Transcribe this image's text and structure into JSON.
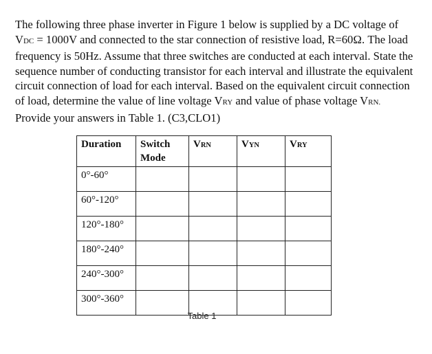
{
  "question": {
    "lines": [
      "The following three phase inverter in Figure 1 below is supplied by a DC voltage of",
      "and connected to the star connection of resistive load, R=60Ω. The load",
      "frequency is 50Hz. Assume that three switches are conducted at each interval. State the",
      "sequence number of conducting transistor for each interval and illustrate the equivalent",
      "circuit connection of load for each interval. Based on the equivalent circuit connection",
      "of load, determine the value of line voltage",
      "and value of phase voltage",
      "Provide your answers in Table 1. (C3,CLO1)"
    ],
    "vdc_symbol": "V",
    "vdc_sub": "DC",
    "vdc_value": " = 1000V ",
    "vry_symbol": "V",
    "vry_sub": "RY",
    "vrn_symbol": "V",
    "vrn_sub": "RN."
  },
  "table": {
    "headers": [
      {
        "main": "Duration",
        "sub": ""
      },
      {
        "main": "Switch Mode",
        "sub": ""
      },
      {
        "main": "V",
        "sub": "RN"
      },
      {
        "main": "V",
        "sub": "YN"
      },
      {
        "main": "V",
        "sub": "RY"
      }
    ],
    "rows": [
      {
        "duration": "0°-60°",
        "switch_mode": "",
        "vrn": "",
        "vyn": "",
        "vry": ""
      },
      {
        "duration": "60°-120°",
        "switch_mode": "",
        "vrn": "",
        "vyn": "",
        "vry": ""
      },
      {
        "duration": "120°-180°",
        "switch_mode": "",
        "vrn": "",
        "vyn": "",
        "vry": ""
      },
      {
        "duration": "180°-240°",
        "switch_mode": "",
        "vrn": "",
        "vyn": "",
        "vry": ""
      },
      {
        "duration": "240°-300°",
        "switch_mode": "",
        "vrn": "",
        "vyn": "",
        "vry": ""
      },
      {
        "duration": "300°-360°",
        "switch_mode": "",
        "vrn": "",
        "vyn": "",
        "vry": ""
      }
    ],
    "caption": "Table 1"
  }
}
